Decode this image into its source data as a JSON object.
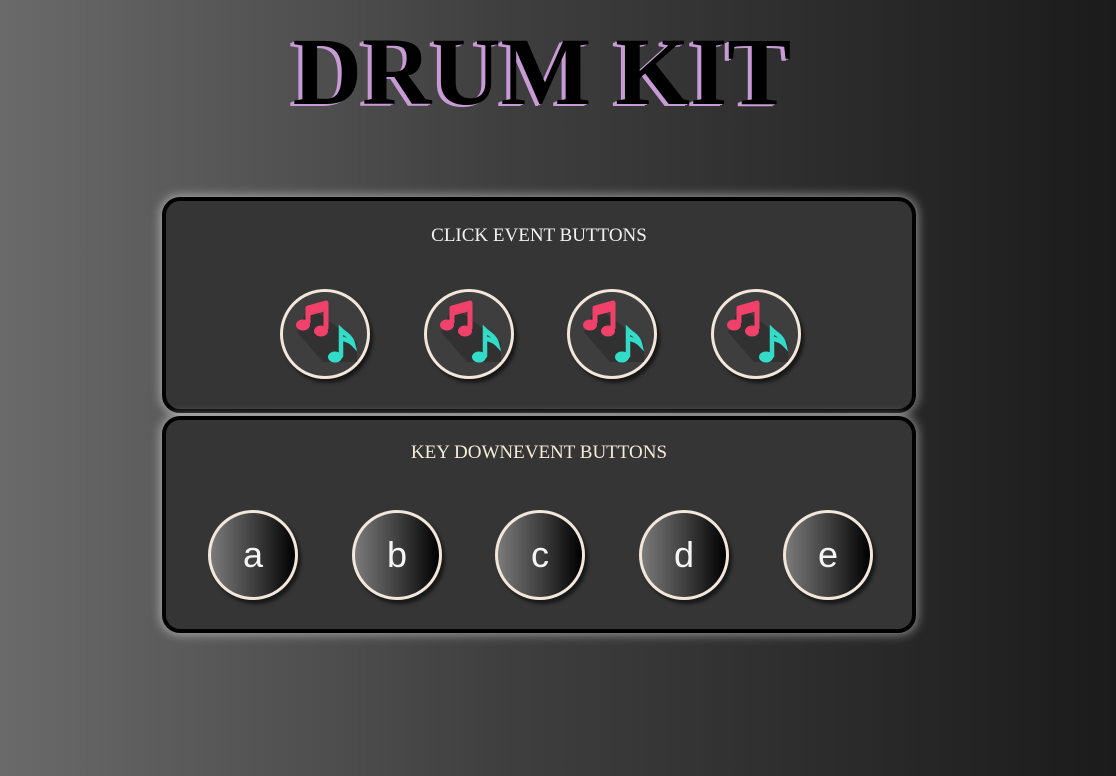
{
  "title": "DRUM KIT",
  "colors": {
    "title_shadow": "#c99bd6",
    "note_pink": "#f0416a",
    "note_teal": "#33dcc8",
    "panel_bg": "#353535",
    "button_border": "#f3e6da"
  },
  "click_section": {
    "heading": "CLICK EVENT BUTTONS",
    "buttons": [
      {
        "icon": "music-notes-icon"
      },
      {
        "icon": "music-notes-icon"
      },
      {
        "icon": "music-notes-icon"
      },
      {
        "icon": "music-notes-icon"
      }
    ]
  },
  "key_section": {
    "heading": "KEY DOWNEVENT BUTTONS",
    "keys": [
      "a",
      "b",
      "c",
      "d",
      "e"
    ]
  }
}
